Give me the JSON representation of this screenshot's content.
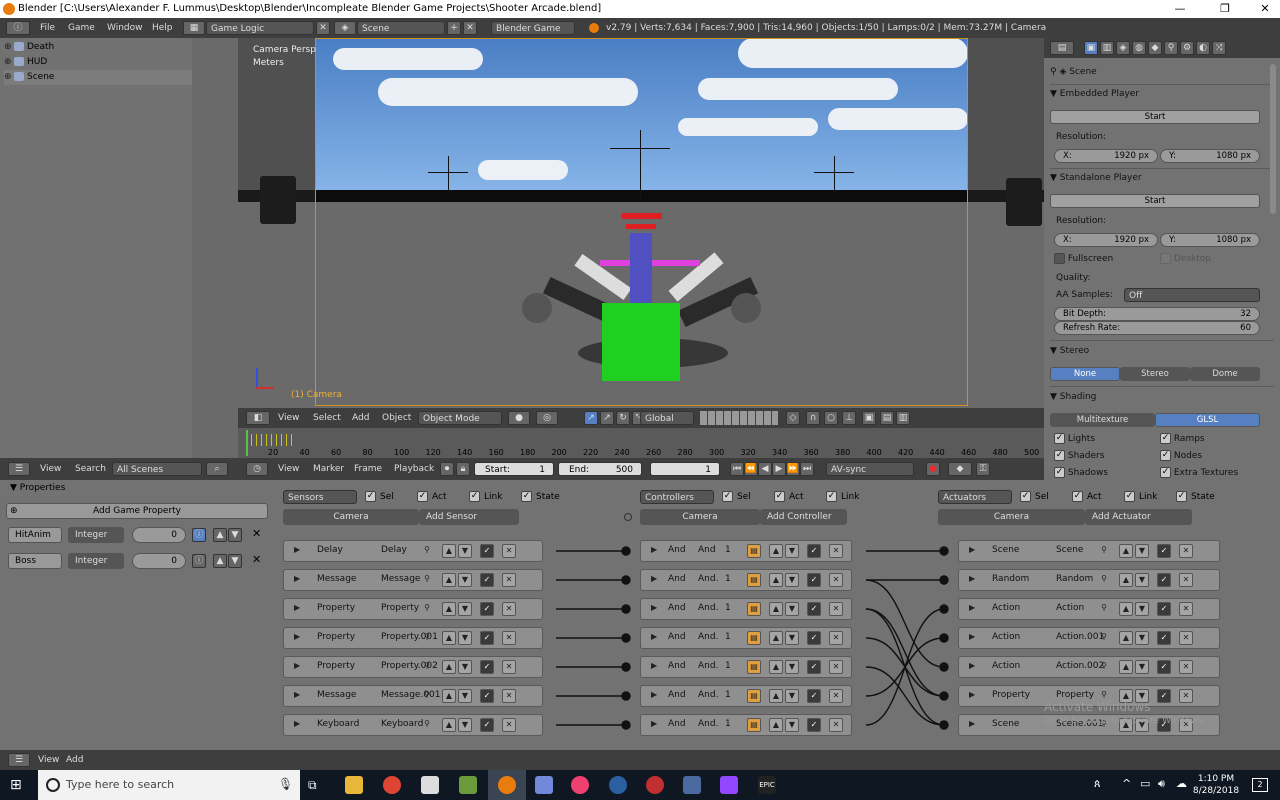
{
  "window": {
    "title": "Blender [C:\\Users\\Alexander F. Lummus\\Desktop\\Blender\\Incompleate Blender Game Projects\\Shooter Arcade.blend]",
    "controls": [
      "—",
      "❐",
      "✕"
    ]
  },
  "infobar": {
    "menus": [
      "File",
      "Game",
      "Window",
      "Help"
    ],
    "screen_layout": "Game Logic",
    "scene": "Scene",
    "engine": "Blender Game",
    "stats": "v2.79 | Verts:7,634 | Faces:7,900 | Tris:14,960 | Objects:1/50 | Lamps:0/2 | Mem:73.27M | Camera"
  },
  "outliner": {
    "items": [
      {
        "label": "Death",
        "selected": false
      },
      {
        "label": "HUD",
        "selected": false
      },
      {
        "label": "Scene",
        "selected": true
      }
    ]
  },
  "viewport": {
    "view_name": "Camera Persp",
    "units": "Meters",
    "active_object": "(1) Camera"
  },
  "viewport_header": {
    "menus": [
      "View",
      "Select",
      "Add",
      "Object"
    ],
    "mode": "Object Mode",
    "orientation": "Global"
  },
  "timeline": {
    "ticks": [
      "20",
      "40",
      "60",
      "80",
      "100",
      "120",
      "140",
      "160",
      "180",
      "200",
      "220",
      "240",
      "260",
      "280",
      "300",
      "320",
      "340",
      "360",
      "380",
      "400",
      "420",
      "440",
      "460",
      "480",
      "500"
    ],
    "menus": [
      "View",
      "Marker",
      "Frame",
      "Playback"
    ],
    "start_label": "Start:",
    "start": "1",
    "end_label": "End:",
    "end": "500",
    "current": "1",
    "sync": "AV-sync"
  },
  "left_header": {
    "menus": [
      "View",
      "Search"
    ],
    "filter": "All Scenes"
  },
  "properties": {
    "title": "Properties",
    "add_button": "Add Game Property",
    "items": [
      {
        "name": "HitAnim",
        "type": "Integer",
        "value": "0"
      },
      {
        "name": "Boss",
        "type": "Integer",
        "value": "0"
      }
    ]
  },
  "logic": {
    "columns": [
      {
        "header": "Sensors",
        "checks": [
          "Sel",
          "Act",
          "Link",
          "State"
        ],
        "object": "Camera",
        "add": "Add Sensor",
        "bricks": [
          {
            "type": "Delay",
            "name": "Delay"
          },
          {
            "type": "Message",
            "name": "Message"
          },
          {
            "type": "Property",
            "name": "Property"
          },
          {
            "type": "Property",
            "name": "Property.001"
          },
          {
            "type": "Property",
            "name": "Property.002"
          },
          {
            "type": "Message",
            "name": "Message.001"
          },
          {
            "type": "Keyboard",
            "name": "Keyboard"
          }
        ]
      },
      {
        "header": "Controllers",
        "checks": [
          "Sel",
          "Act",
          "Link"
        ],
        "object": "Camera",
        "add": "Add Controller",
        "bricks": [
          {
            "type": "And",
            "name": "And",
            "num": "1"
          },
          {
            "type": "And",
            "name": "And.",
            "num": "1"
          },
          {
            "type": "And",
            "name": "And.",
            "num": "1"
          },
          {
            "type": "And",
            "name": "And.",
            "num": "1"
          },
          {
            "type": "And",
            "name": "And.",
            "num": "1"
          },
          {
            "type": "And",
            "name": "And.",
            "num": "1"
          },
          {
            "type": "And",
            "name": "And.",
            "num": "1"
          }
        ]
      },
      {
        "header": "Actuators",
        "checks": [
          "Sel",
          "Act",
          "Link",
          "State"
        ],
        "object": "Camera",
        "add": "Add Actuator",
        "bricks": [
          {
            "type": "Scene",
            "name": "Scene"
          },
          {
            "type": "Random",
            "name": "Random"
          },
          {
            "type": "Action",
            "name": "Action"
          },
          {
            "type": "Action",
            "name": "Action.001"
          },
          {
            "type": "Action",
            "name": "Action.002"
          },
          {
            "type": "Property",
            "name": "Property"
          },
          {
            "type": "Scene",
            "name": "Scene.001"
          }
        ]
      }
    ]
  },
  "render_props": {
    "scene_label": "Scene",
    "embedded_player": "Embedded Player",
    "start": "Start",
    "resolution": "Resolution:",
    "x_label": "X:",
    "y_label": "Y:",
    "res_x": "1920 px",
    "res_y": "1080 px",
    "standalone_player": "Standalone Player",
    "fullscreen": "Fullscreen",
    "desktop": "Desktop",
    "quality": "Quality:",
    "aa_label": "AA Samples:",
    "aa_value": "Off",
    "bit_depth_label": "Bit Depth:",
    "bit_depth": "32",
    "refresh_label": "Refresh Rate:",
    "refresh": "60",
    "stereo": "Stereo",
    "stereo_opts": [
      "None",
      "Stereo",
      "Dome"
    ],
    "shading": "Shading",
    "shading_opts": [
      "Multitexture",
      "GLSL"
    ],
    "shading_checks_left": [
      "Lights",
      "Shaders",
      "Shadows"
    ],
    "shading_checks_right": [
      "Ramps",
      "Nodes",
      "Extra Textures"
    ]
  },
  "bottombar": {
    "menus": [
      "View",
      "Add"
    ]
  },
  "taskbar": {
    "search_placeholder": "Type here to search",
    "time": "1:10 PM",
    "date": "8/28/2018",
    "notifications": "2"
  },
  "watermark": {
    "line1": "Activate Windows",
    "line2": "Go to Settings to activate Windows."
  },
  "colors": {
    "accent": "#5680c2",
    "viewport_frame": "#d09020",
    "cube": "#20d020"
  }
}
